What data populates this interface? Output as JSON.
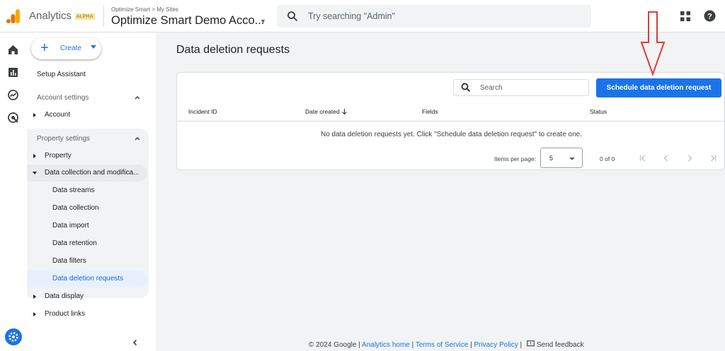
{
  "header": {
    "brand": "Analytics",
    "badge": "ALPHA",
    "breadcrumb_small": "Optimize Smart > My Sites",
    "account_name": "Optimize Smart Demo Acco...",
    "search_placeholder": "Try searching \"Admin\"",
    "colors": {
      "logo_orange": "#f9ab00",
      "logo_dark": "#e37400"
    }
  },
  "rail": {
    "icons": [
      "home-icon",
      "reports-icon",
      "explore-icon",
      "advertising-icon",
      "admin-settings-icon"
    ]
  },
  "nav": {
    "create_label": "Create",
    "setup_assistant": "Setup Assistant",
    "account_settings": "Account settings",
    "account": "Account",
    "property_settings": "Property settings",
    "property": "Property",
    "data_collection_mod": "Data collection and modifica...",
    "sub_items": [
      "Data streams",
      "Data collection",
      "Data import",
      "Data retention",
      "Data filters",
      "Data deletion requests"
    ],
    "data_display": "Data display",
    "product_links": "Product links"
  },
  "main": {
    "title": "Data deletion requests",
    "search_placeholder": "Search",
    "schedule_button": "Schedule data deletion request",
    "columns": [
      "Incident ID",
      "Date created",
      "Fields",
      "Status"
    ],
    "empty_message": "No data deletion requests yet. Click \"Schedule data deletion request\" to create one.",
    "items_per_page_label": "Items per page:",
    "items_per_page_value": "5",
    "range": "0 of 0",
    "accent": "#1a73e8",
    "annotation_color": "#e53935"
  },
  "footer": {
    "copyright": "© 2024 Google |",
    "analytics_home": "Analytics home",
    "sep1": " | ",
    "terms": "Terms of Service",
    "sep2": " | ",
    "privacy": "Privacy Policy",
    "sep3": " | ",
    "feedback": "Send feedback"
  }
}
